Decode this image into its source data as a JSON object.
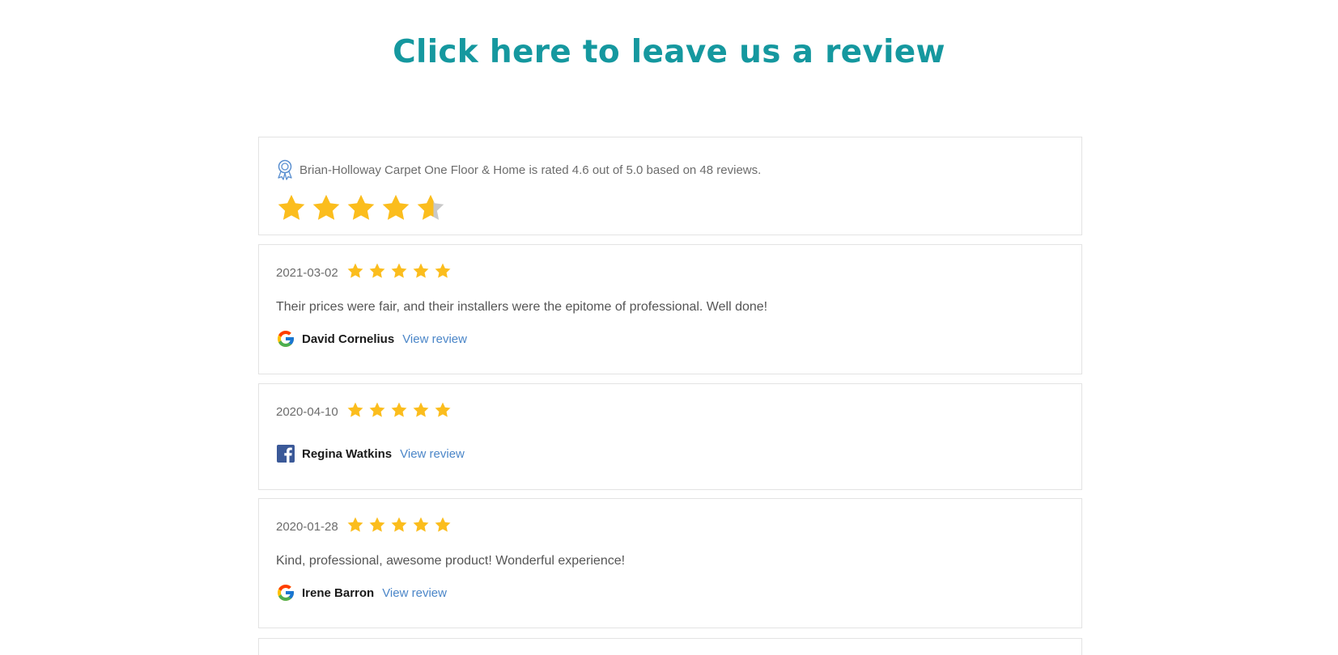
{
  "cta": {
    "label": "Click here to leave us a review"
  },
  "summary": {
    "text": "Brian-Holloway Carpet One Floor & Home is rated 4.6 out of 5.0 based on 48 reviews.",
    "rating": 4.6,
    "max_rating": 5,
    "icon": "award-icon"
  },
  "reviews": [
    {
      "date": "2021-03-02",
      "rating": 5,
      "text": "Their prices were fair, and their installers were the epitome of professional. Well done!",
      "source": "google",
      "author": "David Cornelius",
      "link_label": "View review"
    },
    {
      "date": "2020-04-10",
      "rating": 5,
      "text": "",
      "source": "facebook",
      "author": "Regina Watkins",
      "link_label": "View review"
    },
    {
      "date": "2020-01-28",
      "rating": 5,
      "text": "Kind, professional, awesome product! Wonderful experience!",
      "source": "google",
      "author": "Irene Barron",
      "link_label": "View review"
    }
  ],
  "colors": {
    "accent": "#15989f",
    "star": "#fbbd1d",
    "star_empty": "#c9c9c9",
    "link": "#4b86c8"
  }
}
